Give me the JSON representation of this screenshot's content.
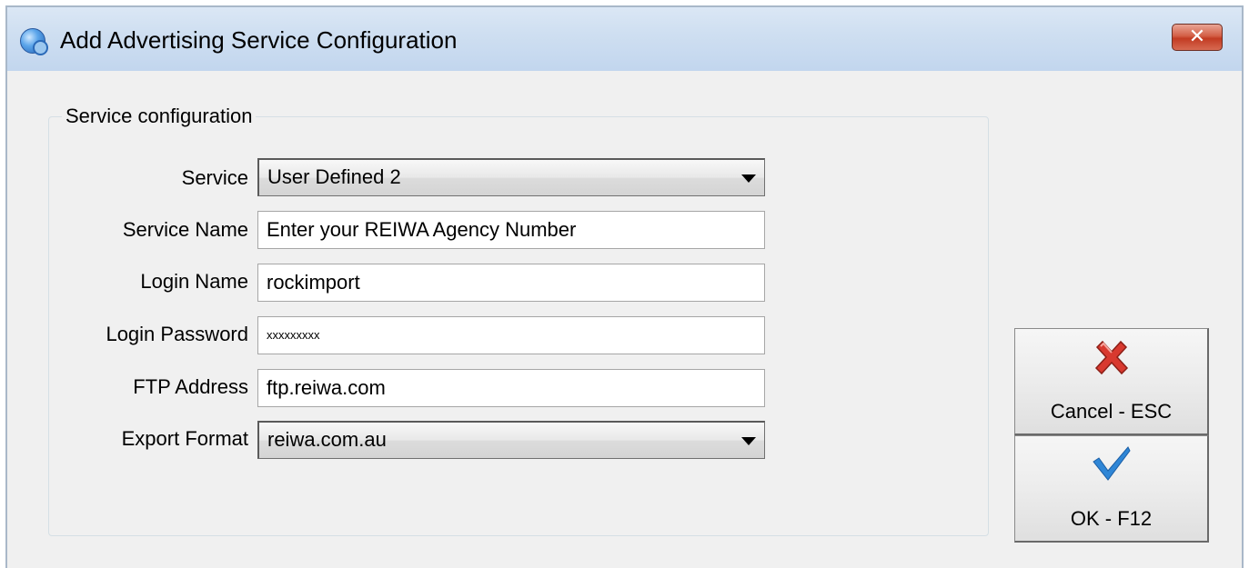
{
  "window": {
    "title": "Add Advertising Service Configuration",
    "close_label": "✕"
  },
  "group": {
    "label": "Service configuration"
  },
  "form": {
    "service": {
      "label": "Service",
      "value": "User Defined 2"
    },
    "service_name": {
      "label": "Service Name",
      "value": "Enter your REIWA Agency Number"
    },
    "login_name": {
      "label": "Login Name",
      "value": "rockimport"
    },
    "login_password": {
      "label": "Login Password",
      "value": "xxxxxxxxx"
    },
    "ftp_address": {
      "label": "FTP Address",
      "value": "ftp.reiwa.com"
    },
    "export_format": {
      "label": "Export Format",
      "value": "reiwa.com.au"
    }
  },
  "buttons": {
    "cancel": {
      "label": "Cancel - ESC",
      "icon": "red-x-icon",
      "color": "#d8392f"
    },
    "ok": {
      "label": "OK - F12",
      "icon": "blue-check-icon",
      "color": "#2f86d6"
    }
  }
}
